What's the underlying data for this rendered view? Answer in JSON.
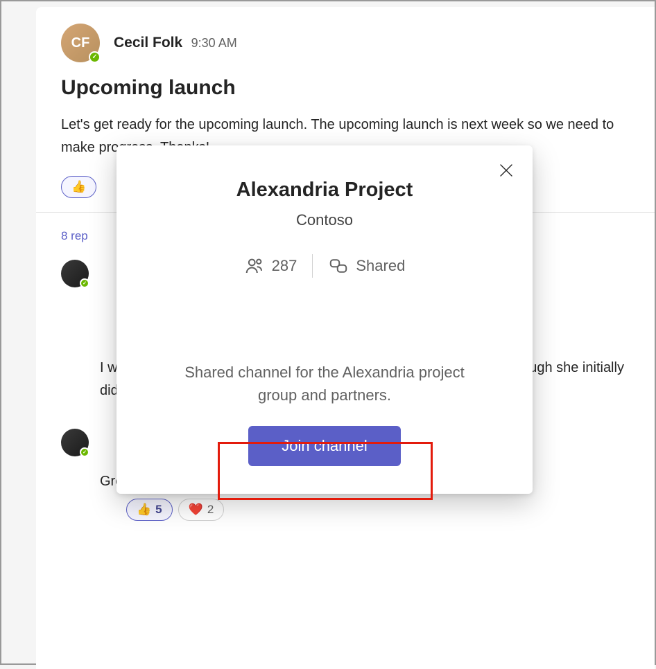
{
  "message": {
    "author": "Cecil Folk",
    "time": "9:30 AM",
    "title": "Upcoming launch",
    "body": "Let's get ready for the upcoming launch. The upcoming launch is next week so we need to make progress. Thanks!",
    "reactions": [
      {
        "emoji": "👍",
        "count": ""
      }
    ]
  },
  "replies": {
    "label": "8 rep",
    "items": [
      {
        "text": "I will have the deck ready by tomorrow, and the team is on track. Although she initially didn't want to present, she agreed to go."
      },
      {
        "text": "Great, I put the meeting on the calendar. Then send me the slides."
      }
    ],
    "bottom_reactions": [
      {
        "emoji": "👍",
        "count": "5"
      },
      {
        "emoji": "❤️",
        "count": "2"
      }
    ]
  },
  "popup": {
    "title": "Alexandria Project",
    "team": "Contoso",
    "members": "287",
    "shared_label": "Shared",
    "description": "Shared channel for the Alexandria project group and partners.",
    "join_label": "Join channel"
  }
}
